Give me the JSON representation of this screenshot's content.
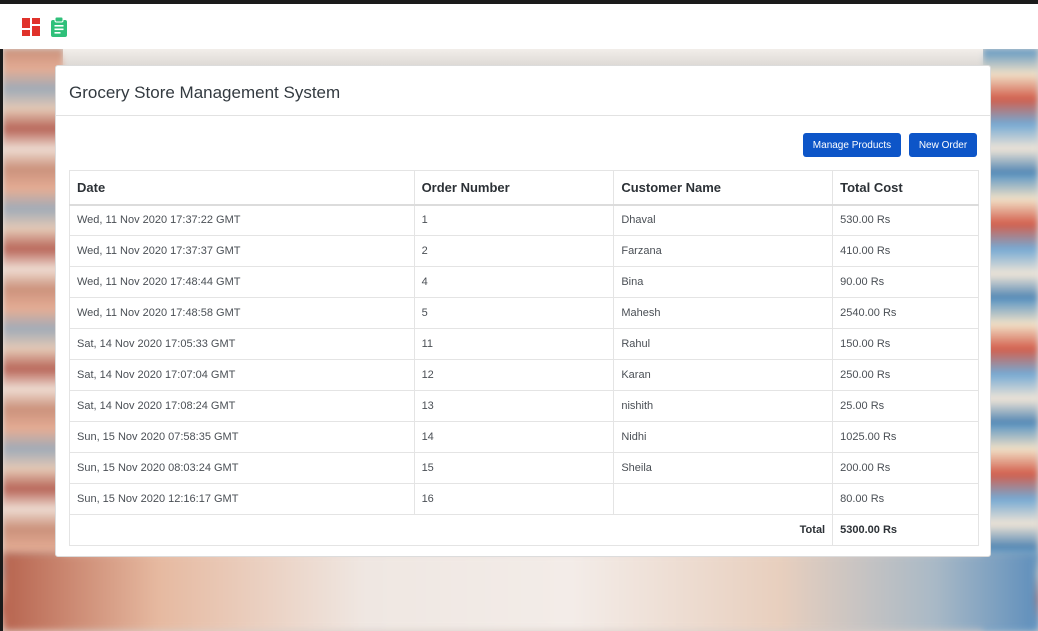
{
  "app": {
    "title": "Grocery Store Management System"
  },
  "topbar": {
    "icons": [
      "dashboard-grid-icon",
      "clipboard-icon"
    ],
    "colors": {
      "grid": "#e0322b",
      "clipboard": "#2fc07a"
    }
  },
  "actions": {
    "manage_products": "Manage Products",
    "new_order": "New Order",
    "color": "#0d55c8"
  },
  "table": {
    "headers": {
      "date": "Date",
      "order_number": "Order Number",
      "customer_name": "Customer Name",
      "total_cost": "Total Cost"
    },
    "rows": [
      {
        "date": "Wed, 11 Nov 2020 17:37:22 GMT",
        "order_number": "1",
        "customer_name": "Dhaval",
        "total_cost": "530.00 Rs"
      },
      {
        "date": "Wed, 11 Nov 2020 17:37:37 GMT",
        "order_number": "2",
        "customer_name": "Farzana",
        "total_cost": "410.00 Rs"
      },
      {
        "date": "Wed, 11 Nov 2020 17:48:44 GMT",
        "order_number": "4",
        "customer_name": "Bina",
        "total_cost": "90.00 Rs"
      },
      {
        "date": "Wed, 11 Nov 2020 17:48:58 GMT",
        "order_number": "5",
        "customer_name": "Mahesh",
        "total_cost": "2540.00 Rs"
      },
      {
        "date": "Sat, 14 Nov 2020 17:05:33 GMT",
        "order_number": "11",
        "customer_name": "Rahul",
        "total_cost": "150.00 Rs"
      },
      {
        "date": "Sat, 14 Nov 2020 17:07:04 GMT",
        "order_number": "12",
        "customer_name": "Karan",
        "total_cost": "250.00 Rs"
      },
      {
        "date": "Sat, 14 Nov 2020 17:08:24 GMT",
        "order_number": "13",
        "customer_name": "nishith",
        "total_cost": "25.00 Rs"
      },
      {
        "date": "Sun, 15 Nov 2020 07:58:35 GMT",
        "order_number": "14",
        "customer_name": "Nidhi",
        "total_cost": "1025.00 Rs"
      },
      {
        "date": "Sun, 15 Nov 2020 08:03:24 GMT",
        "order_number": "15",
        "customer_name": "Sheila",
        "total_cost": "200.00 Rs"
      },
      {
        "date": "Sun, 15 Nov 2020 12:16:17 GMT",
        "order_number": "16",
        "customer_name": "",
        "total_cost": "80.00 Rs"
      }
    ],
    "footer": {
      "label": "Total",
      "value": "5300.00 Rs"
    }
  }
}
